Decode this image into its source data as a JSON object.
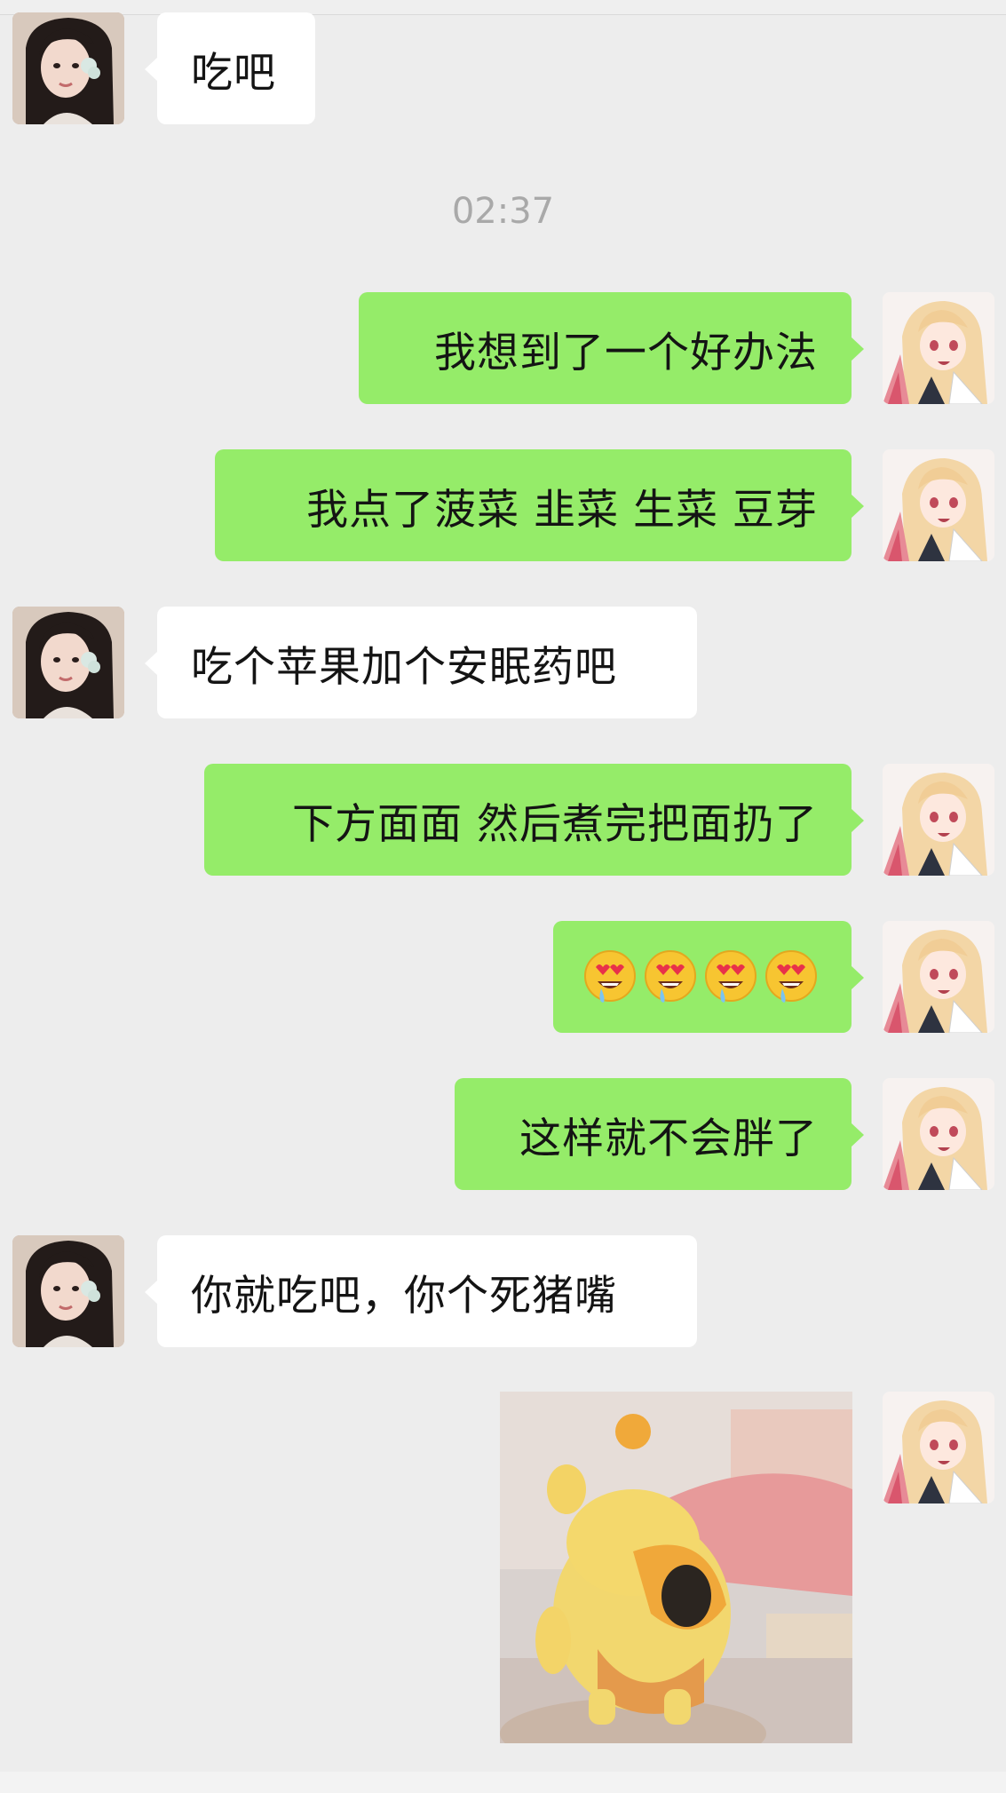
{
  "chat": {
    "timestamp": "02:37",
    "contact_avatar": "girl-photo-avatar",
    "self_avatar": "anime-girl-avatar",
    "messages": [
      {
        "side": "left",
        "text": "吃吧"
      },
      {
        "side": "right",
        "text": "我想到了一个好办法"
      },
      {
        "side": "right",
        "text": "我点了菠菜 韭菜 生菜 豆芽"
      },
      {
        "side": "left",
        "text": "吃个苹果加个安眠药吧"
      },
      {
        "side": "right",
        "text": "下方面面 然后煮完把面扔了"
      },
      {
        "side": "right",
        "emoji": "smiling-face-with-heart-eyes-drooling",
        "count": 4
      },
      {
        "side": "right",
        "text": "这样就不会胖了"
      },
      {
        "side": "left",
        "text": "你就吃吧，你个死猪嘴"
      },
      {
        "side": "right",
        "sticker": "yellow-cartoon-capybara-sticker"
      }
    ]
  },
  "colors": {
    "background": "#ededed",
    "self_bubble": "#95ec69",
    "contact_bubble": "#ffffff",
    "timestamp_text": "#a9a9a9"
  }
}
